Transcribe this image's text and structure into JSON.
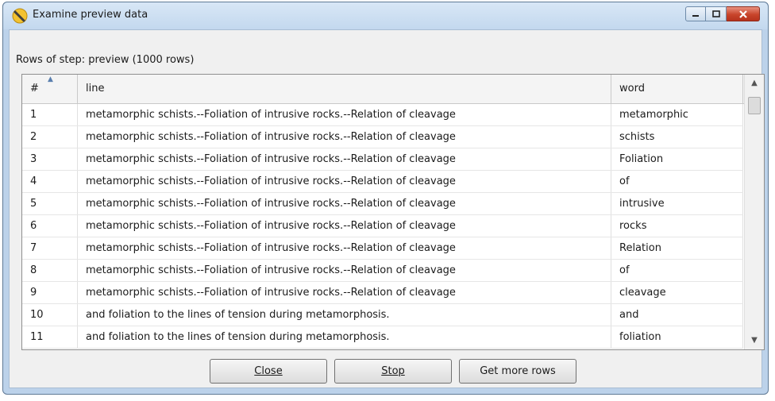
{
  "window": {
    "title": "Examine preview data",
    "icons": {
      "app": "preview-icon",
      "minimize": "minimize-icon",
      "maximize": "maximize-icon",
      "close": "close-icon"
    }
  },
  "step_label": "Rows of step: preview (1000 rows)",
  "table": {
    "columns": [
      "#",
      "line",
      "word"
    ],
    "sort_indicator": "sort-ascending-icon",
    "rows": [
      [
        "1",
        "metamorphic schists.--Foliation of intrusive rocks.--Relation of cleavage",
        "metamorphic"
      ],
      [
        "2",
        "metamorphic schists.--Foliation of intrusive rocks.--Relation of cleavage",
        "schists"
      ],
      [
        "3",
        "metamorphic schists.--Foliation of intrusive rocks.--Relation of cleavage",
        "Foliation"
      ],
      [
        "4",
        "metamorphic schists.--Foliation of intrusive rocks.--Relation of cleavage",
        "of"
      ],
      [
        "5",
        "metamorphic schists.--Foliation of intrusive rocks.--Relation of cleavage",
        "intrusive"
      ],
      [
        "6",
        "metamorphic schists.--Foliation of intrusive rocks.--Relation of cleavage",
        "rocks"
      ],
      [
        "7",
        "metamorphic schists.--Foliation of intrusive rocks.--Relation of cleavage",
        "Relation"
      ],
      [
        "8",
        "metamorphic schists.--Foliation of intrusive rocks.--Relation of cleavage",
        "of"
      ],
      [
        "9",
        "metamorphic schists.--Foliation of intrusive rocks.--Relation of cleavage",
        "cleavage"
      ],
      [
        "10",
        "and foliation to the lines of tension during metamorphosis.",
        "and"
      ],
      [
        "11",
        "and foliation to the lines of tension during metamorphosis.",
        "foliation"
      ]
    ]
  },
  "buttons": {
    "close": "Close",
    "stop": "Stop",
    "get_more_rows": "Get more rows"
  }
}
